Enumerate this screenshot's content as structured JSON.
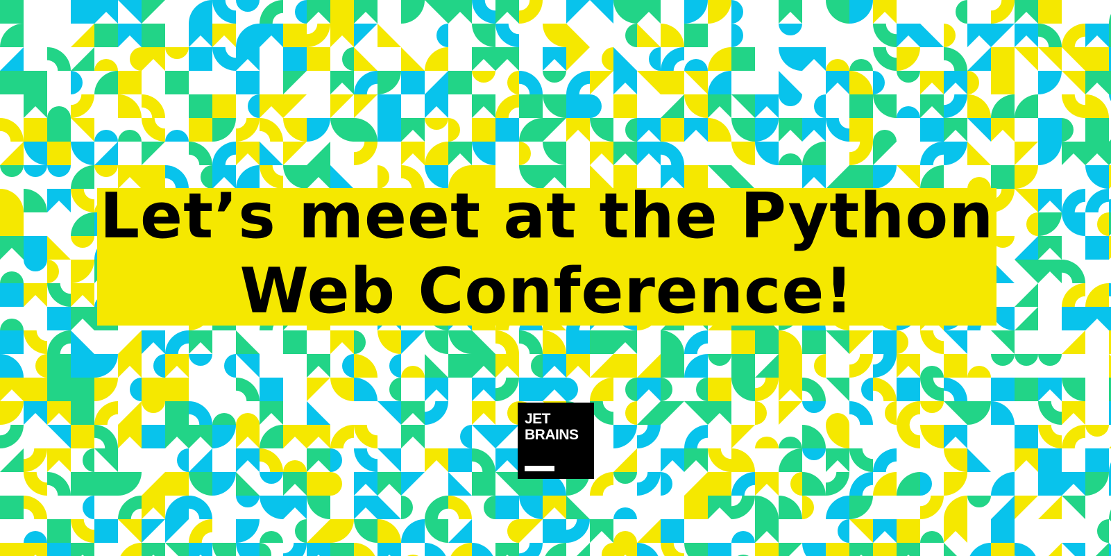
{
  "headline": {
    "line1": "Let’s meet at the Python",
    "line2": "Web Conference!"
  },
  "logo": {
    "line1": "JET",
    "line2": "BRAINS"
  },
  "colors": {
    "yellow": "#f5e800",
    "green": "#22d487",
    "blue": "#08c3ec",
    "headline_box": "#f5e800",
    "text": "#000000",
    "background": "#ffffff"
  }
}
